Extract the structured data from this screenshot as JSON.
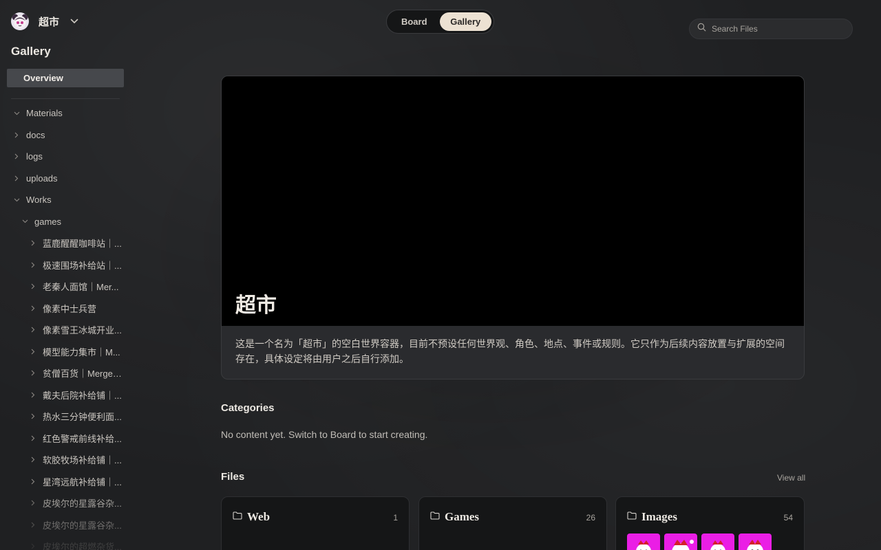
{
  "sidebar": {
    "workspace_name": "超市",
    "title": "Gallery",
    "overview_label": "Overview",
    "tree": [
      {
        "label": "Materials",
        "expanded": true
      },
      {
        "label": "docs",
        "expanded": false
      },
      {
        "label": "logs",
        "expanded": false
      },
      {
        "label": "uploads",
        "expanded": false
      },
      {
        "label": "Works",
        "expanded": true
      },
      {
        "label": "games",
        "expanded": true
      },
      {
        "label": "蓝鹿醒醒咖啡站｜..."
      },
      {
        "label": "极速围场补给站｜..."
      },
      {
        "label": "老秦人面馆｜Mer..."
      },
      {
        "label": "像素中士兵营"
      },
      {
        "label": "像素雪王冰城开业..."
      },
      {
        "label": "模型能力集市｜M..."
      },
      {
        "label": "贫僧百货｜Merge ..."
      },
      {
        "label": "戴夫后院补给铺｜..."
      },
      {
        "label": "热水三分钟便利面..."
      },
      {
        "label": "红色警戒前线补给..."
      },
      {
        "label": "软胶牧场补给铺｜..."
      },
      {
        "label": "星湾远航补给铺｜..."
      },
      {
        "label": "皮埃尔的星露谷杂..."
      },
      {
        "label": "皮埃尔的星露谷杂..."
      },
      {
        "label": "皮埃尔的超燃杂货..."
      }
    ]
  },
  "toggle": {
    "board_label": "Board",
    "gallery_label": "Gallery",
    "active": "Gallery"
  },
  "search": {
    "placeholder": "Search Files"
  },
  "hero": {
    "title": "超市",
    "description": "这是一个名为「超市」的空白世界容器，目前不预设任何世界观、角色、地点、事件或规则。它只作为后续内容放置与扩展的空间存在，具体设定将由用户之后自行添加。"
  },
  "categories": {
    "title": "Categories",
    "empty_text": "No content yet. Switch to Board to start creating."
  },
  "files": {
    "title": "Files",
    "view_all": "View all",
    "cards": [
      {
        "title": "Web",
        "count": "1"
      },
      {
        "title": "Games",
        "count": "26"
      },
      {
        "title": "Images",
        "count": "54"
      }
    ]
  },
  "colors": {
    "accent_toggle": "#ece1d2",
    "thumbnail": "#ea1ee5"
  },
  "icons": [
    "avatar",
    "chevron-down-icon",
    "chevron-right-icon",
    "search-icon",
    "folder-icon"
  ]
}
